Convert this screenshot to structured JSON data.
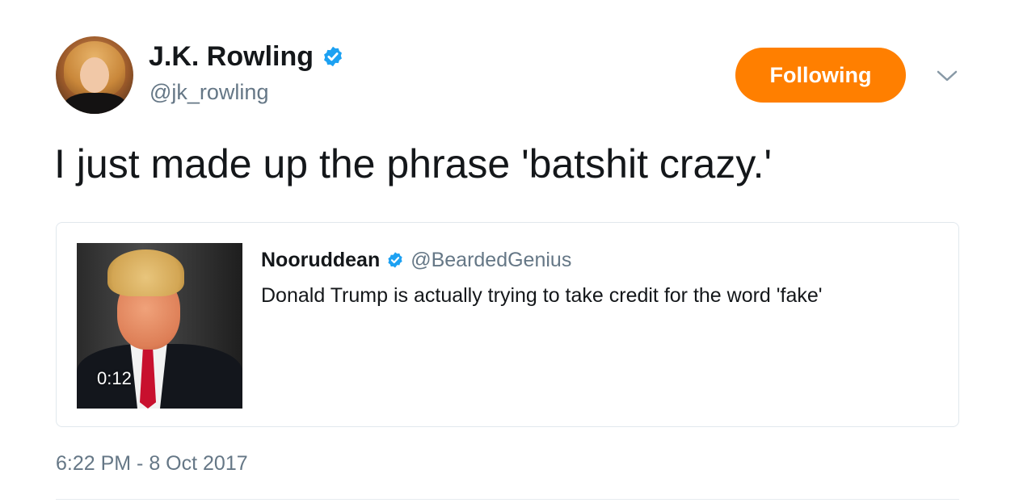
{
  "author": {
    "name": "J.K. Rowling",
    "handle": "@jk_rowling",
    "verified": true
  },
  "follow_button": {
    "label": "Following",
    "color": "#ff7f00"
  },
  "tweet": {
    "text": "I just made up the phrase 'batshit crazy.'",
    "timestamp": "6:22 PM - 8 Oct 2017"
  },
  "quoted_tweet": {
    "author_name": "Nooruddean",
    "author_handle": "@BeardedGenius",
    "verified": true,
    "text": "Donald Trump is actually trying to take credit for the word 'fake'",
    "media": {
      "duration": "0:12"
    }
  },
  "colors": {
    "verified_blue": "#1da1f2",
    "secondary_text": "#657786",
    "border": "#e1e8ed"
  }
}
